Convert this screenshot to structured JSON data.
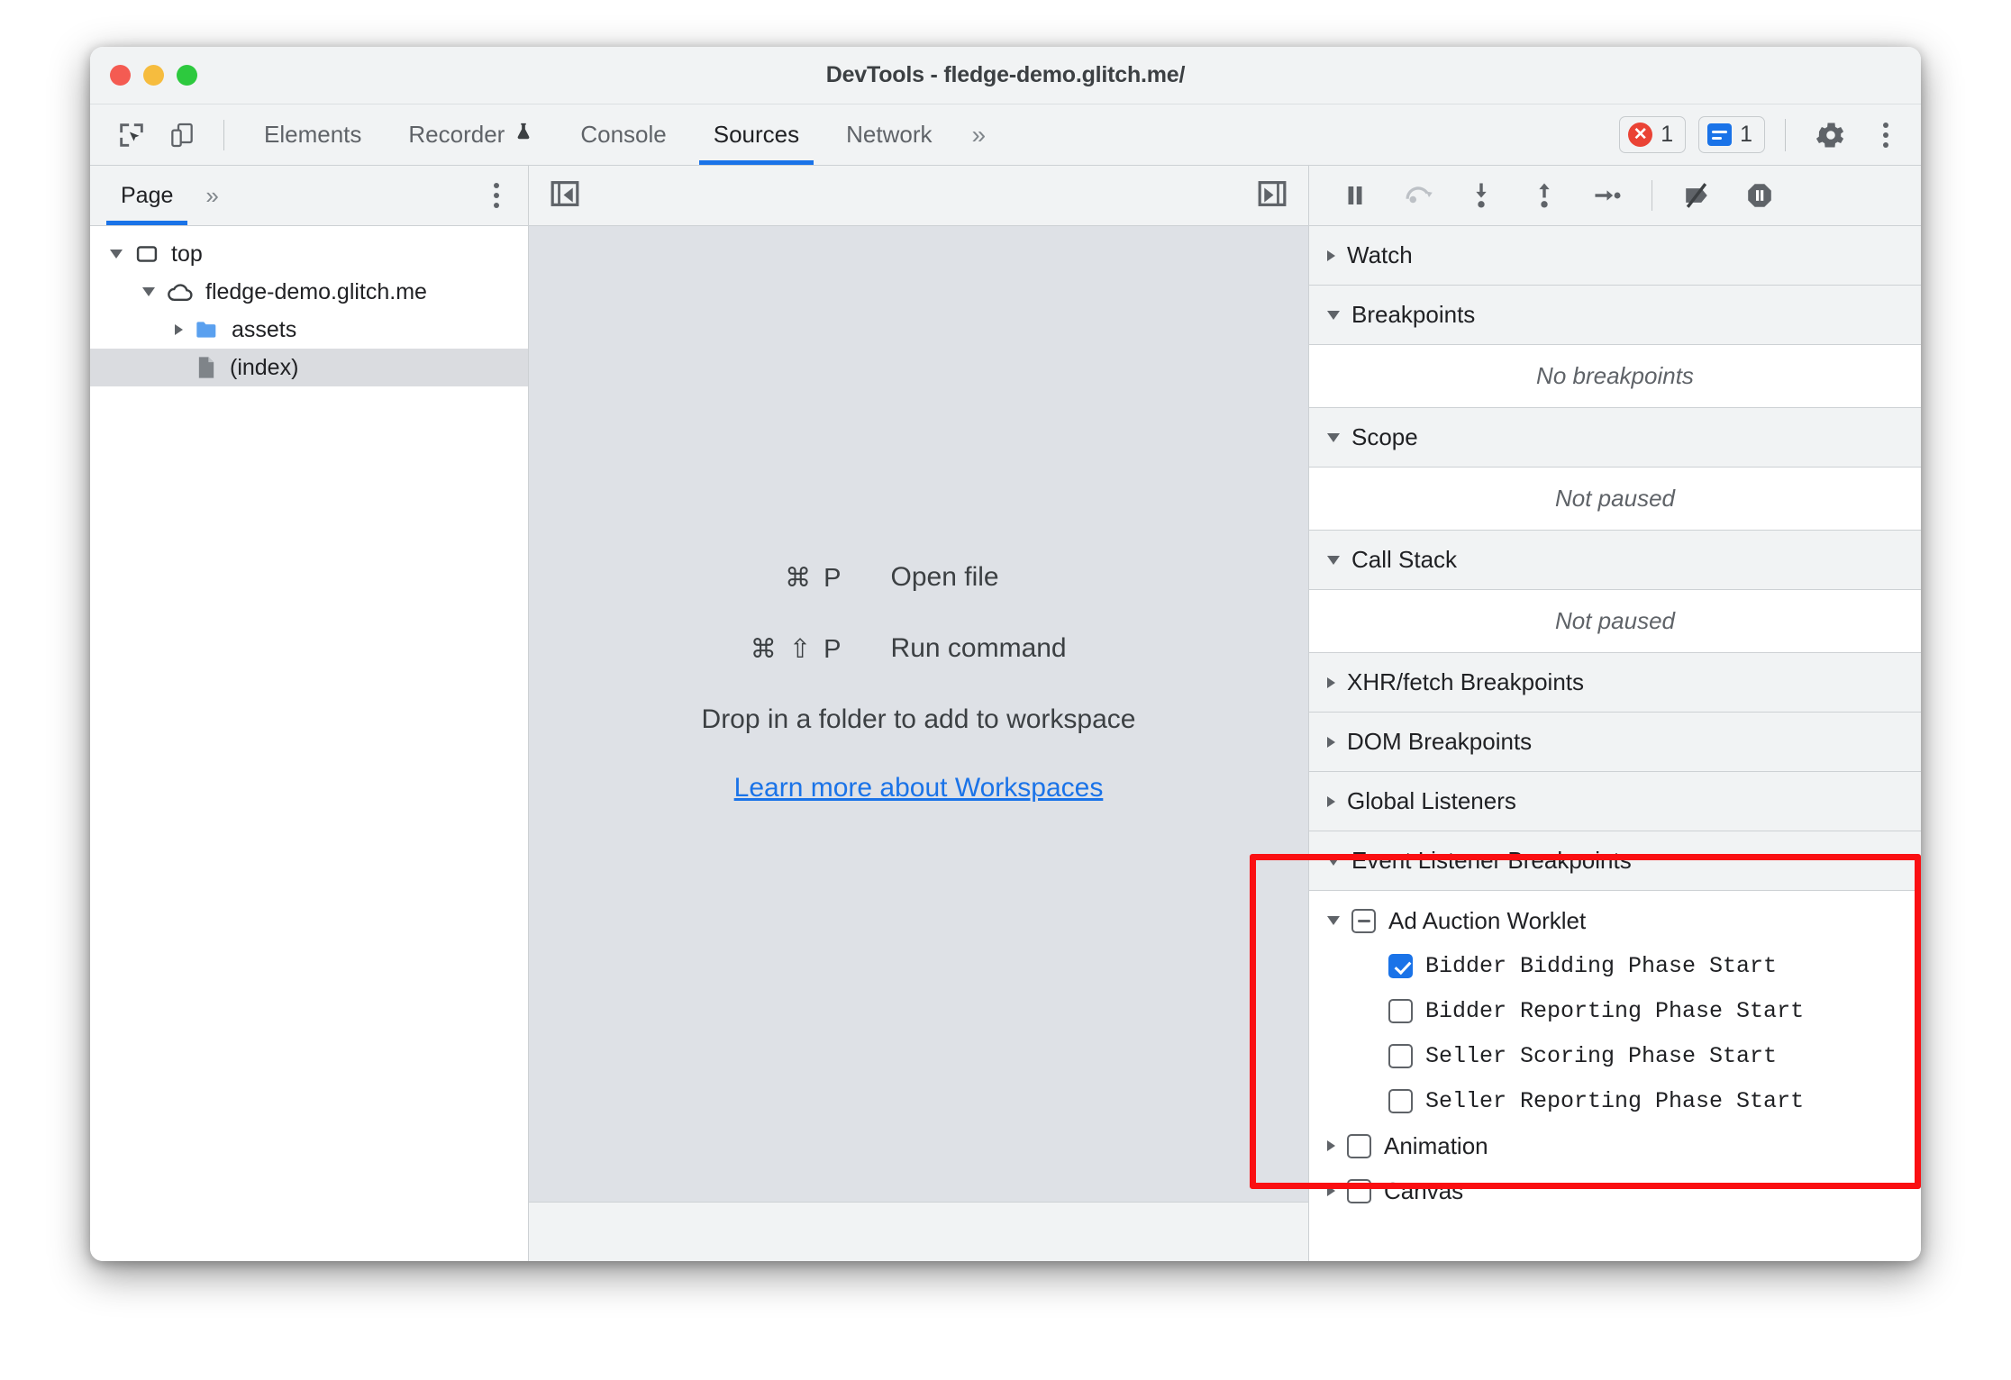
{
  "window": {
    "title": "DevTools - fledge-demo.glitch.me/"
  },
  "toolbar": {
    "inspect_icon": "inspect-cursor-icon",
    "device_icon": "device-toolbar-icon",
    "tabs": [
      {
        "label": "Elements",
        "active": false
      },
      {
        "label": "Recorder",
        "active": false,
        "icon": "flask-icon"
      },
      {
        "label": "Console",
        "active": false
      },
      {
        "label": "Sources",
        "active": true
      },
      {
        "label": "Network",
        "active": false
      }
    ],
    "more_tabs": "»",
    "errors_count": "1",
    "messages_count": "1",
    "settings_icon": "gear-icon",
    "menu_icon": "kebab-menu-icon"
  },
  "navigator": {
    "tab": "Page",
    "more": "»",
    "menu_icon": "kebab-menu-icon",
    "tree": [
      {
        "label": "top",
        "icon": "frame-icon",
        "expanded": true,
        "selected": false
      },
      {
        "label": "fledge-demo.glitch.me",
        "icon": "cloud-icon",
        "expanded": true,
        "selected": false
      },
      {
        "label": "assets",
        "icon": "folder-icon",
        "expanded": false,
        "selected": false
      },
      {
        "label": "(index)",
        "icon": "document-icon",
        "selected": true
      }
    ]
  },
  "editor": {
    "collapse_left_icon": "panel-collapse-left-icon",
    "collapse_right_icon": "panel-expand-right-icon",
    "shortcuts": [
      {
        "keys": "⌘ P",
        "label": "Open file"
      },
      {
        "keys": "⌘ ⇧ P",
        "label": "Run command"
      }
    ],
    "drop_hint": "Drop in a folder to add to workspace",
    "workspaces_link": "Learn more about Workspaces"
  },
  "debugger": {
    "controls": [
      {
        "name": "resume-pause-button",
        "icon": "pause-icon"
      },
      {
        "name": "step-over-button",
        "icon": "step-over-icon"
      },
      {
        "name": "step-into-button",
        "icon": "step-into-icon"
      },
      {
        "name": "step-out-button",
        "icon": "step-out-icon"
      },
      {
        "name": "step-button",
        "icon": "step-icon"
      },
      {
        "name": "deactivate-breakpoints-button",
        "icon": "deactivate-breakpoints-icon"
      },
      {
        "name": "pause-on-exceptions-button",
        "icon": "pause-on-exceptions-icon"
      }
    ],
    "sections": [
      {
        "title": "Watch",
        "expanded": false
      },
      {
        "title": "Breakpoints",
        "expanded": true,
        "empty_text": "No breakpoints"
      },
      {
        "title": "Scope",
        "expanded": true,
        "empty_text": "Not paused"
      },
      {
        "title": "Call Stack",
        "expanded": true,
        "empty_text": "Not paused"
      },
      {
        "title": "XHR/fetch Breakpoints",
        "expanded": false
      },
      {
        "title": "DOM Breakpoints",
        "expanded": false
      },
      {
        "title": "Global Listeners",
        "expanded": false
      },
      {
        "title": "Event Listener Breakpoints",
        "expanded": true
      }
    ],
    "event_listener_breakpoints": {
      "group": {
        "label": "Ad Auction Worklet",
        "expanded": true,
        "state": "indeterminate"
      },
      "items": [
        {
          "label": "Bidder Bidding Phase Start",
          "checked": true
        },
        {
          "label": "Bidder Reporting Phase Start",
          "checked": false
        },
        {
          "label": "Seller Scoring Phase Start",
          "checked": false
        },
        {
          "label": "Seller Reporting Phase Start",
          "checked": false
        }
      ],
      "other_groups": [
        {
          "label": "Animation",
          "checked": false,
          "expanded": false
        },
        {
          "label": "Canvas",
          "checked": false,
          "expanded": false
        }
      ]
    }
  },
  "annotation": {
    "color": "#fa0f12"
  }
}
